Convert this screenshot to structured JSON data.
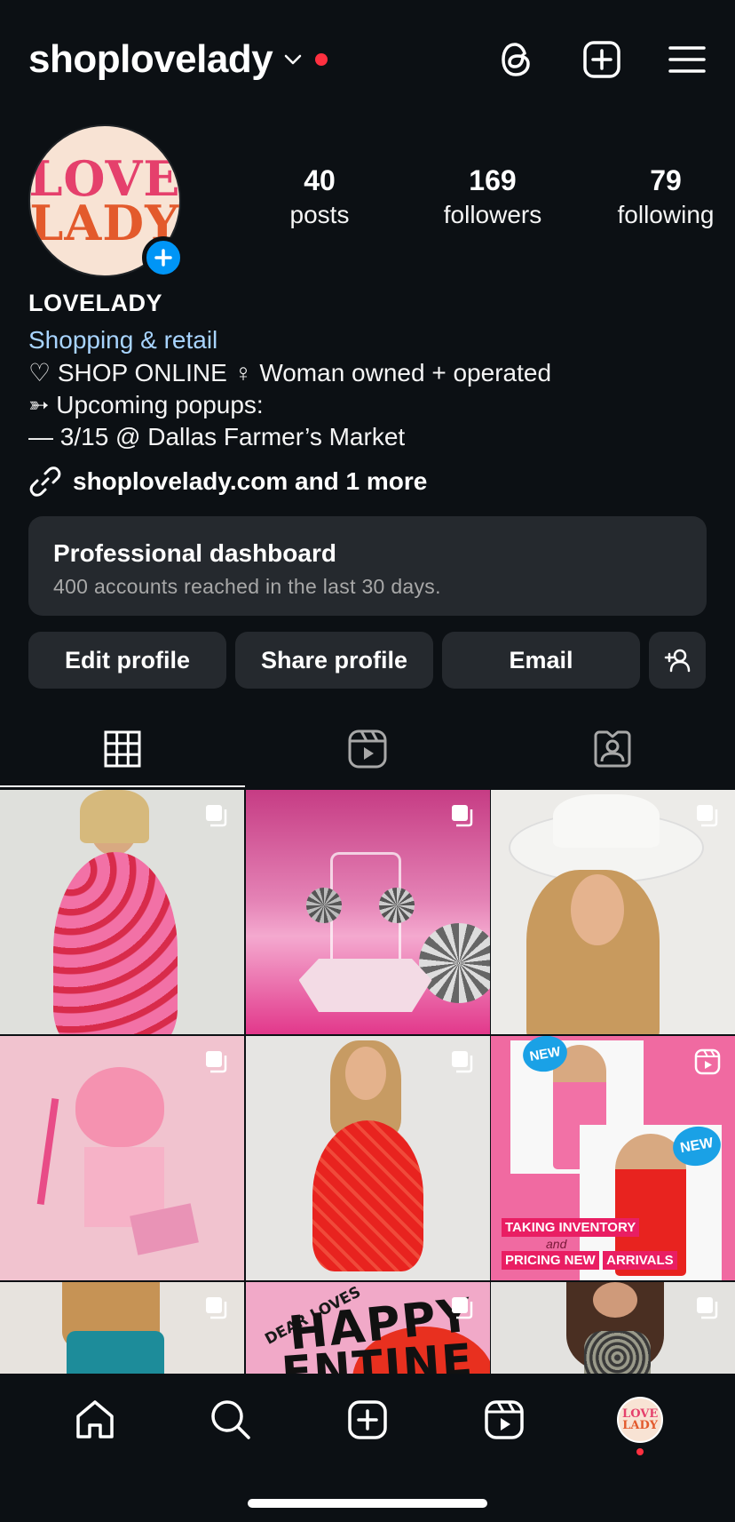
{
  "header": {
    "username": "shoplovelady"
  },
  "profile": {
    "avatar_text": [
      "LOVE",
      "LADY"
    ],
    "stats": [
      {
        "num": "40",
        "label": "posts"
      },
      {
        "num": "169",
        "label": "followers"
      },
      {
        "num": "79",
        "label": "following"
      }
    ],
    "name": "LOVELADY",
    "category": "Shopping & retail",
    "bio_lines": [
      "♡ SHOP ONLINE ♀ Woman owned + operated",
      "➳ Upcoming popups:",
      "— 3/15 @ Dallas Farmer’s Market"
    ],
    "link": "shoplovelady.com and 1 more"
  },
  "dashboard": {
    "title": "Professional dashboard",
    "subtitle": "400 accounts reached in the last 30 days."
  },
  "buttons": {
    "edit": "Edit profile",
    "share": "Share profile",
    "email": "Email"
  },
  "grid": {
    "new_badge": "NEW",
    "reel_text_1": "TAKING INVENTORY",
    "reel_text_2": "and",
    "reel_text_3": "PRICING NEW",
    "reel_text_4": "ARRIVALS",
    "valentine_1": "DEAR LOVES",
    "valentine_2": "HAPPY",
    "valentine_3": "ENTINE"
  },
  "colors": {
    "background": "#0c1014",
    "surface": "#25292e",
    "accent_blue": "#0095f6",
    "link_blue": "#a8d4ff",
    "notification_red": "#ff3040"
  }
}
